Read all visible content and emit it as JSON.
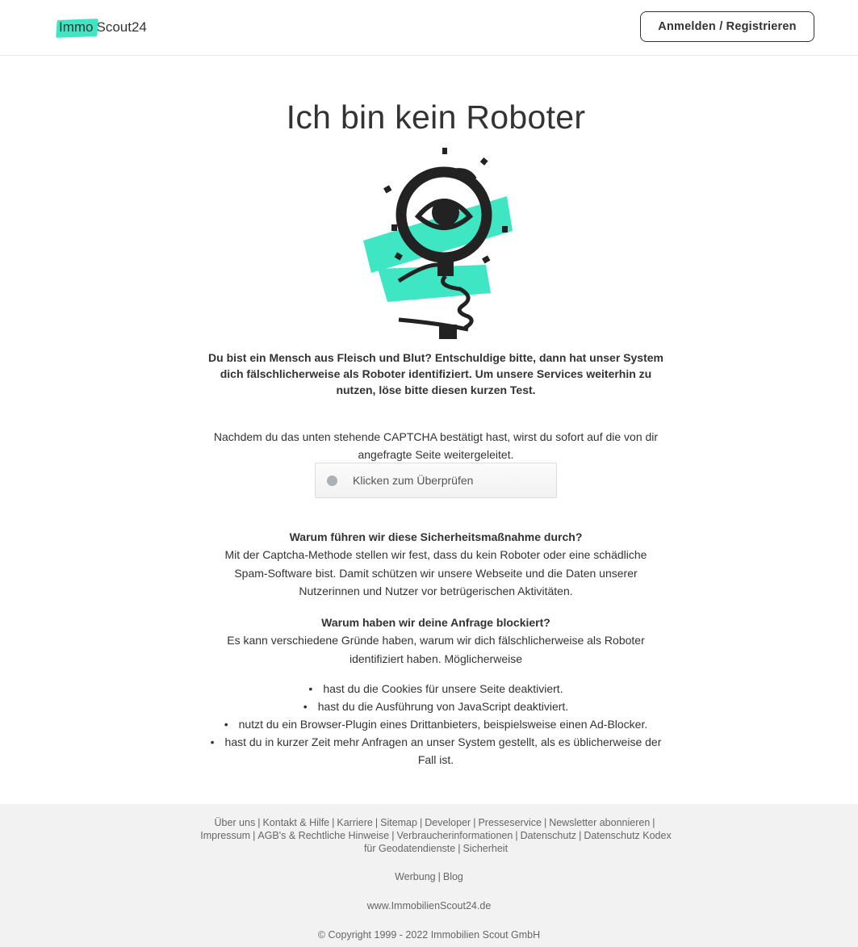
{
  "header": {
    "logo_immo": "Immo",
    "logo_scout": "Scout24",
    "login_label": "Anmelden / Registrieren"
  },
  "main": {
    "title": "Ich bin kein Roboter",
    "intro": "Du bist ein Mensch aus Fleisch und Blut? Entschuldige bitte, dann hat unser System dich fälschlicherweise als Roboter identifiziert. Um unsere Services weiterhin zu nutzen, löse bitte diesen kurzen Test.",
    "captcha_note": "Nachdem du das unten stehende CAPTCHA bestätigt hast, wirst du sofort auf die von dir angefragte Seite weitergeleitet.",
    "captcha_label": "Klicken zum Überprüfen",
    "why_measure_heading": "Warum führen wir diese Sicherheitsmaßnahme durch?",
    "why_measure_text": "Mit der Captcha-Methode stellen wir fest, dass du kein Roboter oder eine schädliche Spam-Software bist. Damit schützen wir unsere Webseite und die Daten unserer Nutzerinnen und Nutzer vor betrügerischen Aktivitäten.",
    "why_blocked_heading": "Warum haben wir deine Anfrage blockiert?",
    "why_blocked_text": "Es kann verschiedene Gründe haben, warum wir dich fälschlicherweise als Roboter identifiziert haben. Möglicherweise",
    "reasons": [
      "hast du die Cookies für unsere Seite deaktiviert.",
      "hast du die Ausführung von JavaScript deaktiviert.",
      "nutzt du ein Browser-Plugin eines Drittanbieters, beispielsweise einen Ad-Blocker.",
      "hast du in kurzer Zeit mehr Anfragen an unser System gestellt, als es üblicherweise der Fall ist."
    ]
  },
  "footer": {
    "links": [
      "Über uns",
      "Kontakt & Hilfe",
      "Karriere",
      "Sitemap",
      "Developer",
      "Presseservice",
      "Newsletter abonnieren",
      "Impressum",
      "AGB's & Rechtliche Hinweise",
      "Verbraucherinformationen",
      "Datenschutz",
      "Datenschutz Kodex für Geodatendienste",
      "Sicherheit"
    ],
    "werbung": "Werbung",
    "blog": "Blog",
    "website": "www.ImmobilienScout24.de",
    "copyright": "© Copyright 1999 - 2022 Immobilien Scout GmbH"
  },
  "colors": {
    "brand_accent": "#3ee6c4",
    "text": "#333333",
    "footer_bg": "#f2f2f2",
    "captcha_dot": "#a9b1b9"
  },
  "icons": {
    "illustration": "magnifying-glass-eye-illustration"
  }
}
